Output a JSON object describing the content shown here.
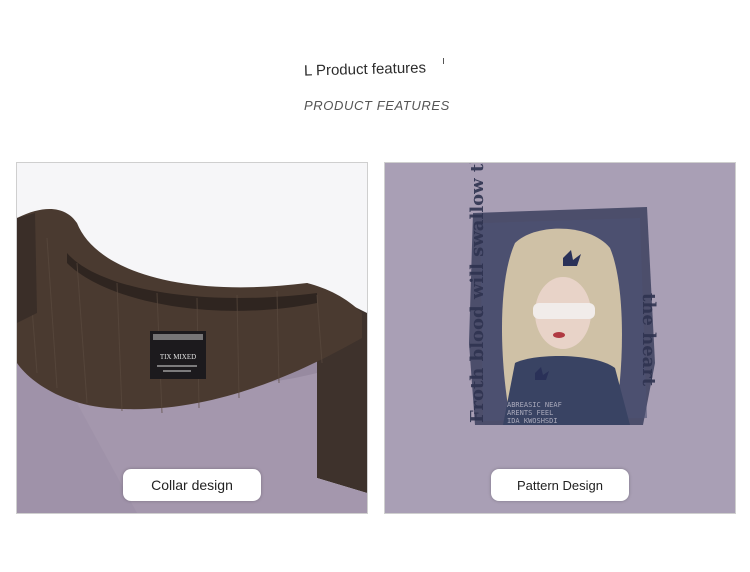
{
  "header": {
    "title": "L Product features",
    "subtitle": "PRODUCT FEATURES"
  },
  "panels": [
    {
      "caption": "Collar design",
      "label_text": "TIX MIXED",
      "colors": {
        "fabric": "#a497ad",
        "ribbing": "#4a3a30"
      }
    },
    {
      "caption": "Pattern Design",
      "print_text": "Froth blood will swallow the heart",
      "colors": {
        "fabric": "#a79cb3",
        "print": "#2f3350"
      }
    }
  ]
}
